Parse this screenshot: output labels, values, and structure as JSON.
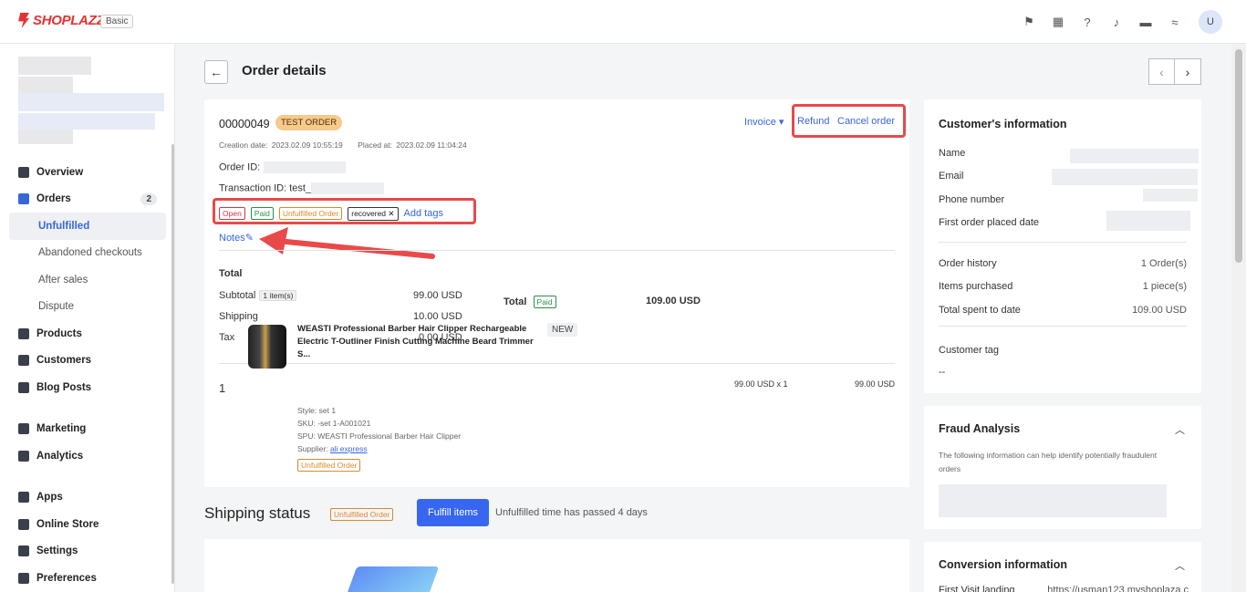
{
  "topbar": {
    "brand": "SHOPLAZZA",
    "plan": "Basic",
    "avatar": "U"
  },
  "sidebar": {
    "items": [
      {
        "label": "Overview",
        "icon": "overview-icon"
      },
      {
        "label": "Orders",
        "icon": "orders-icon",
        "badge": "2"
      },
      {
        "label": "Unfulfilled",
        "sub": true,
        "active": true
      },
      {
        "label": "Abandoned checkouts",
        "sub": true
      },
      {
        "label": "After sales",
        "sub": true
      },
      {
        "label": "Dispute",
        "sub": true
      },
      {
        "label": "Products",
        "icon": "products-icon"
      },
      {
        "label": "Customers",
        "icon": "customers-icon"
      },
      {
        "label": "Blog Posts",
        "icon": "blog-icon"
      },
      {
        "label": "Marketing",
        "icon": "marketing-icon"
      },
      {
        "label": "Analytics",
        "icon": "analytics-icon"
      },
      {
        "label": "Apps",
        "icon": "apps-icon"
      },
      {
        "label": "Online Store",
        "icon": "store-icon"
      },
      {
        "label": "Settings",
        "icon": "settings-icon"
      },
      {
        "label": "Preferences",
        "icon": "preferences-icon"
      }
    ]
  },
  "page": {
    "title": "Order details"
  },
  "order": {
    "number": "00000049",
    "test_tag": "TEST ORDER",
    "invoice": "Invoice",
    "refund": "Refund",
    "cancel": "Cancel order",
    "creation_label": "Creation date:",
    "creation_date": "2023.02.09 10:55:19",
    "placed_label": "Placed at:",
    "placed_date": "2023.02.09 11:04:24",
    "order_id_label": "Order ID:",
    "transaction_label": "Transaction ID: test_",
    "tags": {
      "open": "Open",
      "paid": "Paid",
      "unfulfilled": "Unfulfilled Order",
      "recovered": "recovered",
      "add": "Add tags"
    },
    "notes": "Notes"
  },
  "totals": {
    "title": "Total",
    "subtotal_label": "Subtotal",
    "items_count": "1 item(s)",
    "subtotal": "99.00 USD",
    "shipping_label": "Shipping",
    "shipping": "10.00 USD",
    "tax_label": "Tax",
    "tax": "0.00 USD",
    "total_label": "Total",
    "paid": "Paid",
    "total": "109.00 USD"
  },
  "product": {
    "index": "1",
    "name": "WEASTI Professional Barber Hair Clipper Rechargeable Electric T-Outliner Finish Cutting Machine Beard Trimmer S...",
    "style": "Style: set 1",
    "sku": "SKU: -set 1-A001021",
    "spu": "SPU: WEASTI Professional Barber Hair Clipper",
    "supplier_label": "Supplier:",
    "supplier": "ali express",
    "status": "Unfulfilled Order",
    "new": "NEW",
    "price_qty": "99.00 USD x 1",
    "line_total": "99.00 USD"
  },
  "shipping": {
    "title": "Shipping status",
    "status": "Unfulfilled Order",
    "button": "Fulfill items",
    "note": "Unfulfilled time has passed 4 days"
  },
  "customer": {
    "title": "Customer's information",
    "name": "Name",
    "email": "Email",
    "phone": "Phone number",
    "first_order": "First order placed date",
    "history_label": "Order history",
    "history": "1 Order(s)",
    "items_label": "Items purchased",
    "items": "1 piece(s)",
    "spent_label": "Total spent to date",
    "spent": "109.00 USD",
    "tag_label": "Customer tag",
    "tag": "--"
  },
  "fraud": {
    "title": "Fraud Analysis",
    "desc": "The following information can help identify potentially fraudulent orders"
  },
  "conversion": {
    "title": "Conversion information",
    "first_visit": "First Visit landing",
    "url": "https://usman123.myshoplaza.c"
  }
}
